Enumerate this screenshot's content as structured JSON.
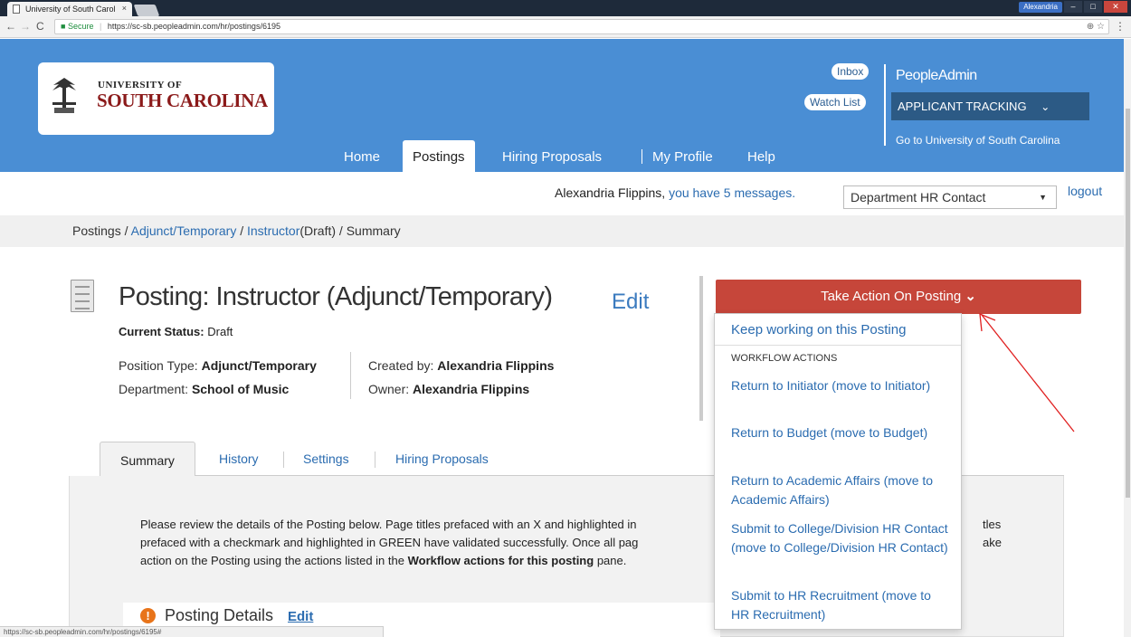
{
  "browser": {
    "tab_title": "University of South Carol",
    "tab_close": "×",
    "window_user": "Alexandria",
    "url_secure": "Secure",
    "url": "https://sc-sb.peopleadmin.com/hr/postings/6195",
    "status_url": "https://sc-sb.peopleadmin.com/hr/postings/6195#"
  },
  "header": {
    "logo_line1": "UNIVERSITY OF",
    "logo_line2": "SOUTH CAROLINA",
    "inbox": "Inbox",
    "watch_list": "Watch List",
    "brand": "PeopleAdmin",
    "module": "APPLICANT TRACKING",
    "goto": "Go to University of South Carolina",
    "nav": [
      "Home",
      "Postings",
      "Hiring Proposals",
      "My Profile",
      "Help"
    ]
  },
  "messages": {
    "user": "Alexandria Flippins,",
    "link": "you have 5 messages.",
    "role": "Department HR Contact",
    "logout": "logout"
  },
  "breadcrumb": {
    "root": "Postings",
    "sep": "/",
    "cat": "Adjunct/Temporary",
    "item": "Instructor",
    "state": "(Draft)",
    "last": "Summary"
  },
  "posting": {
    "title": "Posting: Instructor (Adjunct/Temporary)",
    "edit": "Edit",
    "status_label": "Current Status:",
    "status_value": "Draft",
    "position_type_label": "Position Type:",
    "position_type": "Adjunct/Temporary",
    "department_label": "Department:",
    "department": "School of Music",
    "created_by_label": "Created by:",
    "created_by": "Alexandria Flippins",
    "owner_label": "Owner:",
    "owner": "Alexandria Flippins"
  },
  "action": {
    "button": "Take Action On Posting",
    "keep": "Keep working on this Posting",
    "header": "WORKFLOW ACTIONS",
    "items": [
      "Return to Initiator (move to Initiator)",
      "Return to Budget (move to Budget)",
      "Return to Academic Affairs (move to Academic Affairs)",
      "Submit to College/Division HR Contact (move to College/Division HR Contact)",
      "Submit to HR Recruitment (move to HR Recruitment)"
    ]
  },
  "tabs": [
    "Summary",
    "History",
    "Settings",
    "Hiring Proposals"
  ],
  "intro": {
    "line1_a": "Please review the details of the Posting below.  Page titles prefaced with an X and highlighted in",
    "line1_b": "tles",
    "line2_a": "prefaced with a checkmark and highlighted in GREEN have validated successfully.  Once all pag",
    "line2_b": "ake",
    "line3_a": "action on the Posting using the actions listed in the",
    "line3_bold": "Workflow actions for this posting",
    "line3_c": "pane."
  },
  "details": {
    "title": "Posting Details",
    "edit": "Edit"
  },
  "colors": {
    "header_blue": "#4a8ed4",
    "action_red": "#c6463a",
    "link_blue": "#2b6cb0",
    "annotation_arrow": "#e02020"
  }
}
